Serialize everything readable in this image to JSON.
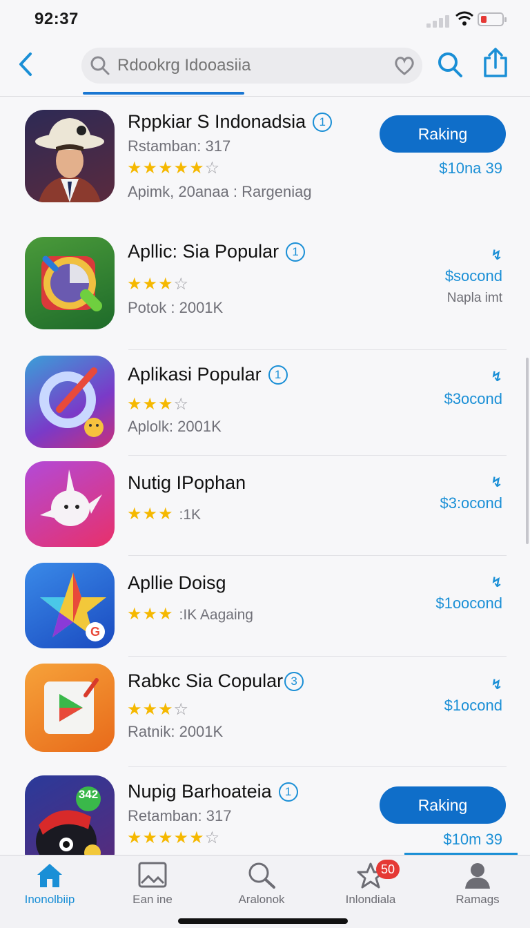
{
  "status_bar": {
    "time": "92:37"
  },
  "header": {
    "search_placeholder": "Rdookrg Idooasiia"
  },
  "apps": [
    {
      "name": "Rppkiar S Indonadsia",
      "badge": "1",
      "meta1": "Rstamban: 317",
      "stars": "★★★★★",
      "stars_empty": "☆",
      "count": "",
      "meta2": "Apimk, 20anaa  :  Rargeniag",
      "button": "Raking",
      "price": "$10na 39",
      "price_sub": "",
      "dl": ""
    },
    {
      "name": "Apllic: Sia Popular",
      "badge": "1",
      "meta1": "",
      "stars": "★★★",
      "stars_empty": "☆",
      "count": "",
      "meta2": "Potok : 2001K",
      "button": "",
      "price": "$socond",
      "price_sub": "Napla imt",
      "dl": "↯"
    },
    {
      "name": "Aplikasi Popular",
      "badge": "1",
      "meta1": "",
      "stars": "★★★",
      "stars_empty": "☆",
      "count": "",
      "meta2": "Aplolk: 2001K",
      "button": "",
      "price": "$3ocond",
      "price_sub": "",
      "dl": "↯"
    },
    {
      "name": "Nutig IPophan",
      "badge": "",
      "meta1": "",
      "stars": "★★★",
      "stars_empty": "",
      "count": ":1K",
      "meta2": "",
      "button": "",
      "price": "$3:ocond",
      "price_sub": "",
      "dl": "↯"
    },
    {
      "name": "Apllie Doisg",
      "badge": "",
      "meta1": "",
      "stars": "★★★",
      "stars_empty": "",
      "count": ":IK  Aagaing",
      "meta2": "",
      "button": "",
      "price": "$1oocond",
      "price_sub": "",
      "dl": "↯"
    },
    {
      "name": "Rabkc Sia Copular",
      "badge": "3",
      "meta1": "",
      "stars": "★★★",
      "stars_empty": "☆",
      "count": "",
      "meta2": "Ratnik: 2001K",
      "button": "",
      "price": "$1ocond",
      "price_sub": "",
      "dl": "↯"
    },
    {
      "name": "Nupig Barhoateia",
      "badge": "1",
      "meta1": "Retamban: 317",
      "stars": "★★★★★",
      "stars_empty": "☆",
      "count": "",
      "meta2": "",
      "button": "Raking",
      "price": "$10m 39",
      "price_sub": "",
      "dl": "",
      "icon_badge": "342"
    }
  ],
  "tabs": [
    {
      "label": "Inonolbiip",
      "active": true
    },
    {
      "label": "Ean ine",
      "active": false
    },
    {
      "label": "Aralonok",
      "active": false
    },
    {
      "label": "Inlondiala",
      "active": false,
      "badge": "50"
    },
    {
      "label": "Ramags",
      "active": false
    }
  ],
  "colors": {
    "accent": "#1a8fd6",
    "button": "#0f6ec9",
    "star": "#f5b800",
    "badge": "#e53935"
  }
}
